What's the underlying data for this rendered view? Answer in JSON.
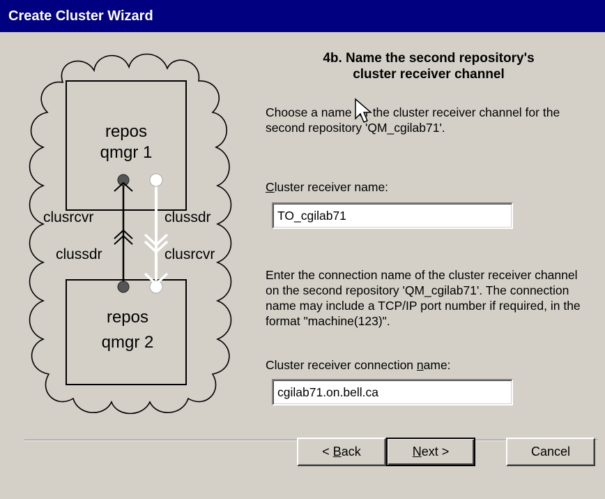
{
  "window": {
    "title": "Create Cluster Wizard"
  },
  "diagram": {
    "qmgr1": {
      "line1": "repos",
      "line2": "qmgr 1"
    },
    "qmgr2": {
      "line1": "repos",
      "line2": "qmgr 2"
    },
    "label_clusrcvr_left": "clusrcvr",
    "label_clussdr_right": "clussdr",
    "label_clussdr_left": "clussdr",
    "label_clusrcvr_right": "clusrcvr",
    "colors": {
      "cloud": "#000000",
      "box": "#000000",
      "white_channel": "#ffffff",
      "dark_channel": "#000000"
    }
  },
  "step": {
    "heading_line1": "4b. Name the second repository's",
    "heading_line2": "cluster receiver channel",
    "intro": "Choose a name for the cluster receiver channel for the second repository 'QM_cgilab71'.",
    "receiver_name": {
      "label_prefix": "",
      "label_accel": "C",
      "label_rest": "luster receiver name:",
      "value": "TO_cgilab71"
    },
    "connection_help": "Enter the connection name of the cluster receiver channel on the second repository 'QM_cgilab71'. The connection name may include a TCP/IP port number if required, in the format \"machine(123)\".",
    "connection_name": {
      "label_prefix": "Cluster receiver connection ",
      "label_accel": "n",
      "label_rest": "ame:",
      "value": "cgilab71.on.bell.ca"
    }
  },
  "buttons": {
    "back": {
      "prefix": "< ",
      "accel": "B",
      "rest": "ack"
    },
    "next": {
      "prefix": "",
      "accel": "N",
      "rest": "ext >"
    },
    "cancel": "Cancel"
  }
}
